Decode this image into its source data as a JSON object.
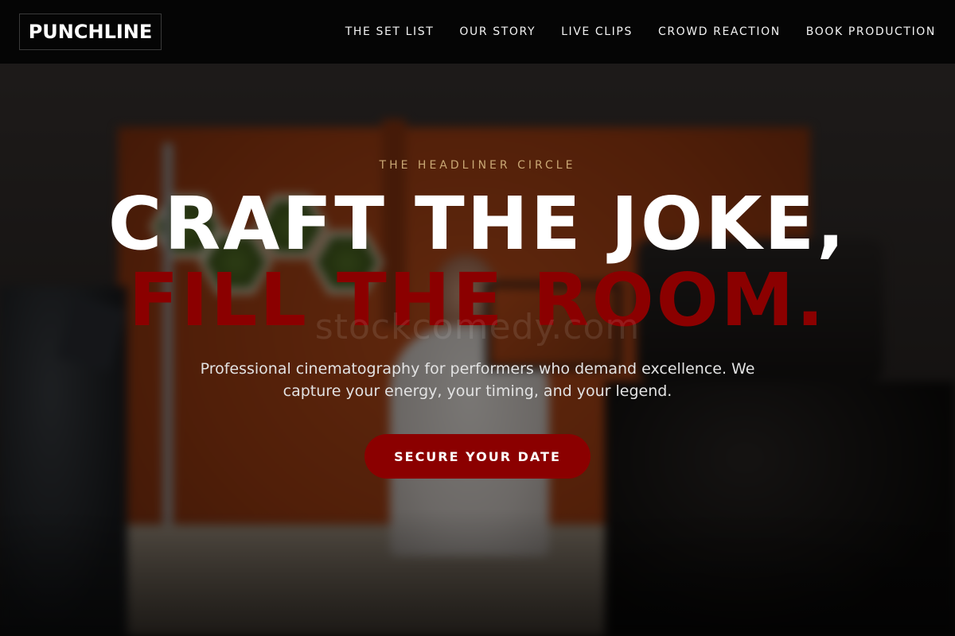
{
  "header": {
    "logo": "PUNCHLINE",
    "nav": [
      {
        "label": "THE SET LIST"
      },
      {
        "label": "OUR STORY"
      },
      {
        "label": "LIVE CLIPS"
      },
      {
        "label": "CROWD REACTION"
      },
      {
        "label": "BOOK PRODUCTION"
      }
    ]
  },
  "hero": {
    "eyebrow": "THE HEADLINER CIRCLE",
    "headline_line1": "CRAFT THE JOKE,",
    "headline_line2": "FILL THE ROOM.",
    "watermark": "stockcomedy.com",
    "subtitle": "Professional cinematography for performers who demand excellence. We capture your energy, your timing, and your legend.",
    "cta_label": "SECURE YOUR DATE"
  },
  "colors": {
    "accent": "#8b0000",
    "eyebrow": "#c9a774",
    "header_bg": "#050505"
  }
}
